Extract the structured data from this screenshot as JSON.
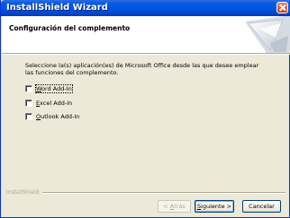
{
  "window": {
    "title": "InstallShield Wizard"
  },
  "header": {
    "title": "Configuración del complemento"
  },
  "main": {
    "instruction": "Seleccione la(s) aplicación(es) de Microsoft Office desde las que desee emplear las funciones del complemento.",
    "checkboxes": [
      {
        "prefix": "",
        "hotkey": "W",
        "rest": "ord Add-In",
        "checked": false
      },
      {
        "prefix": "",
        "hotkey": "E",
        "rest": "xcel Add-In",
        "checked": false
      },
      {
        "prefix": "",
        "hotkey": "O",
        "rest": "utlook Add-In",
        "checked": false
      }
    ]
  },
  "footer": {
    "brand": "InstallShield",
    "back": {
      "prefix": "< ",
      "hotkey": "A",
      "rest": "trás"
    },
    "next": {
      "hotkey": "S",
      "rest": "iguiente >"
    },
    "cancel": "Cancelar"
  },
  "colors": {
    "titlebar": "#0054e3",
    "face": "#ece9d8",
    "close": "#c6411e"
  }
}
